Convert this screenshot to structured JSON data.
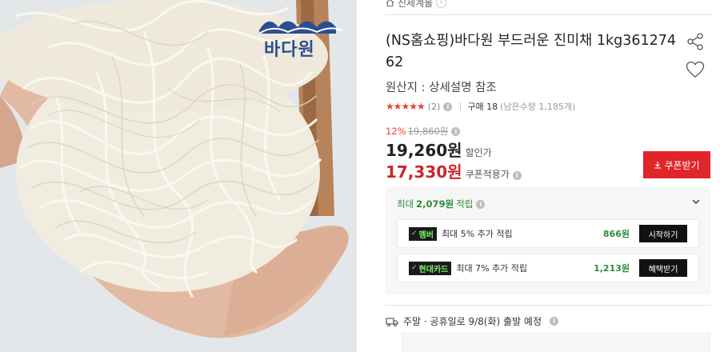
{
  "breadcrumb": {
    "label": "신세계몰"
  },
  "brand": {
    "logo_text": "바다원"
  },
  "product": {
    "title": "(NS홈쇼핑)바다원 부드러운 진미채 1kg36127462",
    "origin": "원산지 : 상세설명 참조",
    "rating_stars": "★★★★★",
    "review_count": "(2)",
    "purchase": "구매 18",
    "remaining": "(남은수량 1,185개)"
  },
  "pricing": {
    "discount_rate": "12%",
    "original_price": "19,860원",
    "sale_price": "19,260원",
    "sale_label": "할인가",
    "coupon_price": "17,330원",
    "coupon_label": "쿠폰적용가",
    "coupon_button": "쿠폰받기"
  },
  "points": {
    "prefix": "최대",
    "amount": "2,079원",
    "suffix": "적립",
    "cards": [
      {
        "badge": "멤버",
        "desc": "최대 5% 추가 적립",
        "amount": "866원",
        "button": "시작하기"
      },
      {
        "badge": "현대카드",
        "desc": "최대 7% 추가 적립",
        "amount": "1,213원",
        "button": "혜택받기"
      }
    ]
  },
  "shipping": {
    "text": "주말 · 공휴일로 9/8(화) 출발 예정"
  },
  "icons": {
    "info": "i"
  },
  "colors": {
    "accent_red": "#e0252b",
    "price_red": "#c9262b",
    "points_green": "#2e8b3a",
    "brand_blue": "#2b4e93"
  }
}
